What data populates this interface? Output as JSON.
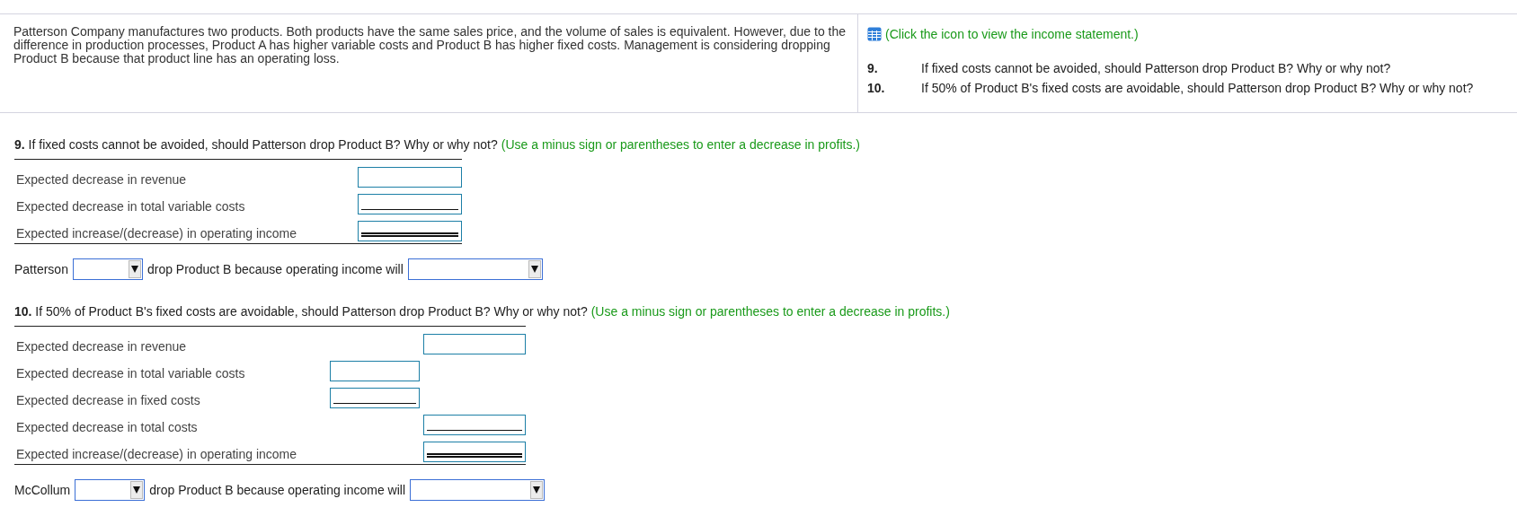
{
  "intro": {
    "text": "Patterson Company manufactures two products. Both products have the same sales price, and the volume of sales is equivalent. However, due to the difference in production processes, Product A has higher variable costs and Product B has higher fixed costs. Management is considering dropping Product B because that product line has an operating loss.",
    "link": "(Click the icon to view the income statement.)",
    "questions": [
      {
        "number": "9.",
        "text": "If fixed costs cannot be avoided, should Patterson drop Product B? Why or why not?"
      },
      {
        "number": "10.",
        "text": "If 50% of Product B's fixed costs are avoidable, should Patterson drop Product B? Why or why not?"
      }
    ]
  },
  "parts": [
    {
      "question": "**9.** If fixed costs cannot be avoided, should Patterson drop Product B? Why or why not?",
      "hint": "(Use a minus sign or parentheses to enter a decrease in profits.)",
      "rows": [
        {
          "label": "Expected decrease in revenue",
          "kind": "plain"
        },
        {
          "label": "Expected decrease in total variable costs",
          "kind": "subtotal"
        },
        {
          "label": "Expected increase/(decrease) in operating income",
          "kind": "total"
        }
      ],
      "sentence": {
        "subject": "Patterson",
        "middle": "drop Product B because operating income will"
      }
    },
    {
      "question": "**10.** If 50% of Product B's fixed costs are avoidable, should Patterson drop Product B? Why or why not?",
      "hint": "(Use a minus sign or parentheses to enter a decrease in profits.)",
      "rows": [
        {
          "label": "Expected decrease in revenue",
          "kind": "plain"
        },
        {
          "label": "Expected decrease in total variable costs",
          "kind": "indent"
        },
        {
          "label": "Expected decrease in fixed costs",
          "kind": "indentsubtotal"
        },
        {
          "label": "Expected decrease in total costs",
          "kind": "subtotal"
        },
        {
          "label": "Expected increase/(decrease) in operating income",
          "kind": "total"
        }
      ],
      "sentence": {
        "subject": "McCollum",
        "middle": "drop Product B because operating income will"
      }
    }
  ]
}
